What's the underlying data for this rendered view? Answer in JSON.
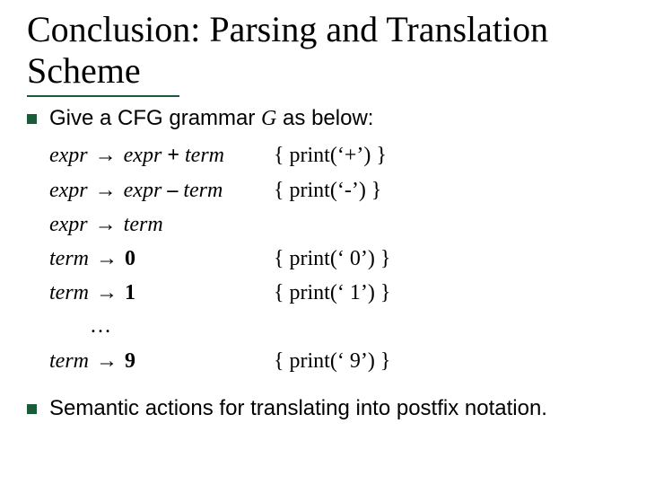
{
  "title": "Conclusion: Parsing and Translation Scheme",
  "bullets": {
    "b1_prefix": "Give a CFG grammar ",
    "b1_g": "G",
    "b1_suffix": " as below:",
    "b2": "Semantic actions for translating into postfix notation."
  },
  "rules": [
    {
      "lhs_a": "expr",
      "arrow": "→",
      "lhs_b": "expr",
      "op": " + ",
      "lhs_c": "term",
      "action": "{ print(‘+’) }"
    },
    {
      "lhs_a": "expr",
      "arrow": "→",
      "lhs_b": "expr",
      "op": " – ",
      "lhs_c": "term",
      "action": "{ print(‘-’) }"
    },
    {
      "lhs_a": "expr",
      "arrow": "→",
      "lhs_b": "term",
      "op": "",
      "lhs_c": "",
      "action": ""
    },
    {
      "lhs_a": "term",
      "arrow": "→",
      "lhs_b": "",
      "op": "0",
      "lhs_c": "",
      "action": "{ print(‘ 0’) }"
    },
    {
      "lhs_a": "term",
      "arrow": "→",
      "lhs_b": "",
      "op": "1",
      "lhs_c": "",
      "action": "{ print(‘ 1’) }"
    }
  ],
  "ellipsis": "…",
  "rule_last": {
    "lhs_a": "term",
    "arrow": "→",
    "lhs_b": "",
    "op": "9",
    "lhs_c": "",
    "action": "{ print(‘ 9’) }"
  }
}
